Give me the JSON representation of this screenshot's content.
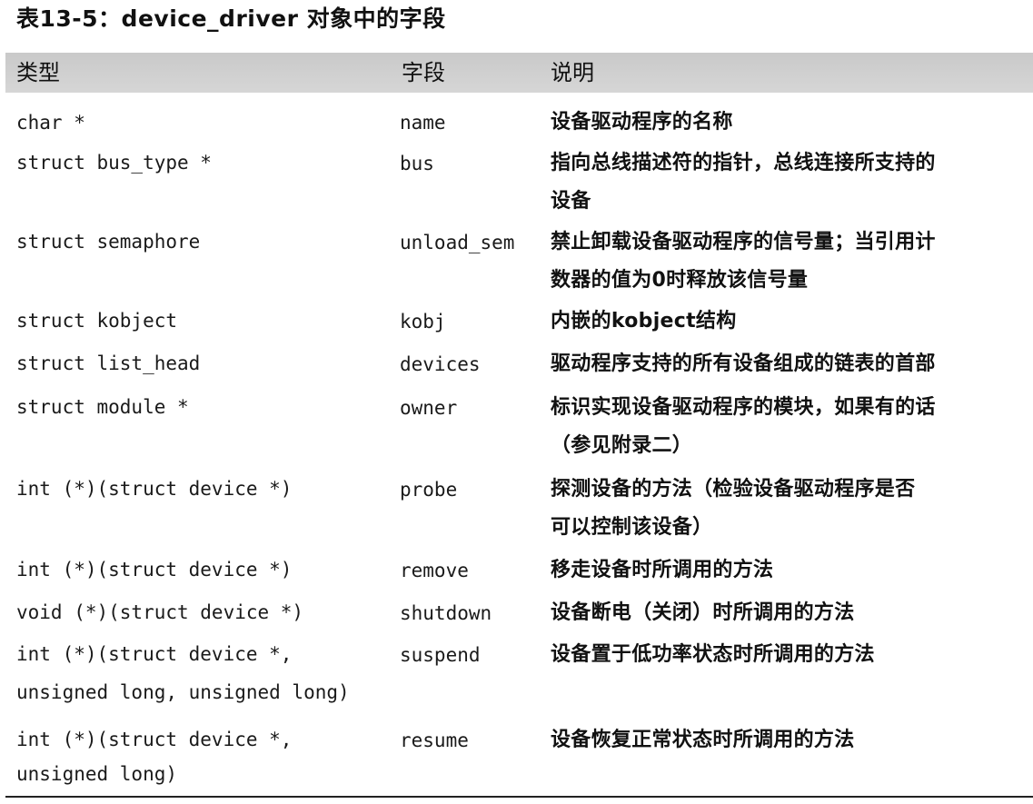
{
  "caption": "表13-5：device_driver 对象中的字段",
  "headers": {
    "type": "类型",
    "field": "字段",
    "desc": "说明"
  },
  "rows": [
    {
      "type": [
        "char *"
      ],
      "field": "name",
      "desc": [
        "设备驱动程序的名称"
      ]
    },
    {
      "type": [
        "struct bus_type *"
      ],
      "field": "bus",
      "desc": [
        "指向总线描述符的指针，总线连接所支持的",
        "设备"
      ]
    },
    {
      "type": [
        "struct semaphore"
      ],
      "field": "unload_sem",
      "desc": [
        "禁止卸载设备驱动程序的信号量；当引用计",
        "数器的值为0时释放该信号量"
      ]
    },
    {
      "type": [
        "struct kobject"
      ],
      "field": "kobj",
      "desc": [
        "内嵌的kobject结构"
      ]
    },
    {
      "type": [
        "struct list_head"
      ],
      "field": "devices",
      "desc": [
        "驱动程序支持的所有设备组成的链表的首部"
      ]
    },
    {
      "type": [
        "struct module *"
      ],
      "field": "owner",
      "desc": [
        "标识实现设备驱动程序的模块，如果有的话",
        "（参见附录二）"
      ]
    },
    {
      "type": [
        "int (*)(struct device *)"
      ],
      "field": "probe",
      "desc": [
        "探测设备的方法（检验设备驱动程序是否",
        "可以控制该设备）"
      ]
    },
    {
      "type": [
        "int (*)(struct device *)"
      ],
      "field": "remove",
      "desc": [
        "移走设备时所调用的方法"
      ]
    },
    {
      "type": [
        "void (*)(struct device *)"
      ],
      "field": "shutdown",
      "desc": [
        "设备断电（关闭）时所调用的方法"
      ]
    },
    {
      "type": [
        "int (*)(struct device *,",
        "unsigned long, unsigned long)"
      ],
      "field": "suspend",
      "desc": [
        "设备置于低功率状态时所调用的方法"
      ]
    },
    {
      "type": [
        "int (*)(struct device *,",
        "unsigned long)"
      ],
      "field": "resume",
      "desc": [
        "设备恢复正常状态时所调用的方法"
      ]
    }
  ]
}
